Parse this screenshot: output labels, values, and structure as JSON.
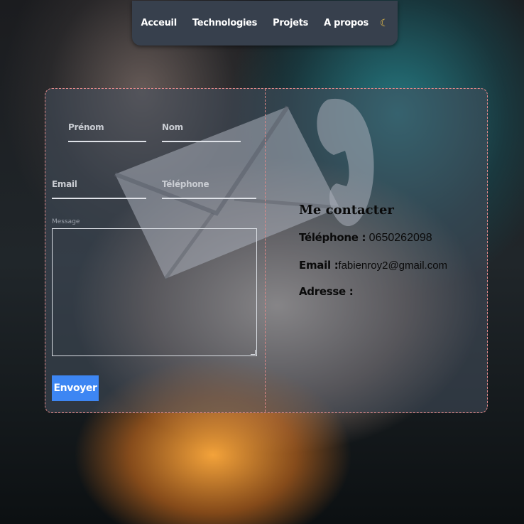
{
  "nav": {
    "items": [
      "Acceuil",
      "Technologies",
      "Projets",
      "A propos"
    ],
    "theme_icon": "moon-icon",
    "moon_color": "#f3c64a"
  },
  "form": {
    "first_name_label": "Prénom",
    "last_name_label": "Nom",
    "email_label": "Email",
    "phone_label": "Téléphone",
    "message_label": "Message",
    "submit_label": "Envoyer",
    "submit_color": "#3d86f3"
  },
  "contact": {
    "title": "Me contacter",
    "phone_key": "Téléphone :",
    "phone_value": " 0650262098",
    "email_key": "Email :",
    "email_value": "fabienroy2@gmail.com",
    "address_key": "Adresse :",
    "address_value": ""
  },
  "decor": {
    "background_icons": [
      "envelope-icon",
      "telephone-handset-icon"
    ],
    "border_color": "#e58a8a"
  }
}
